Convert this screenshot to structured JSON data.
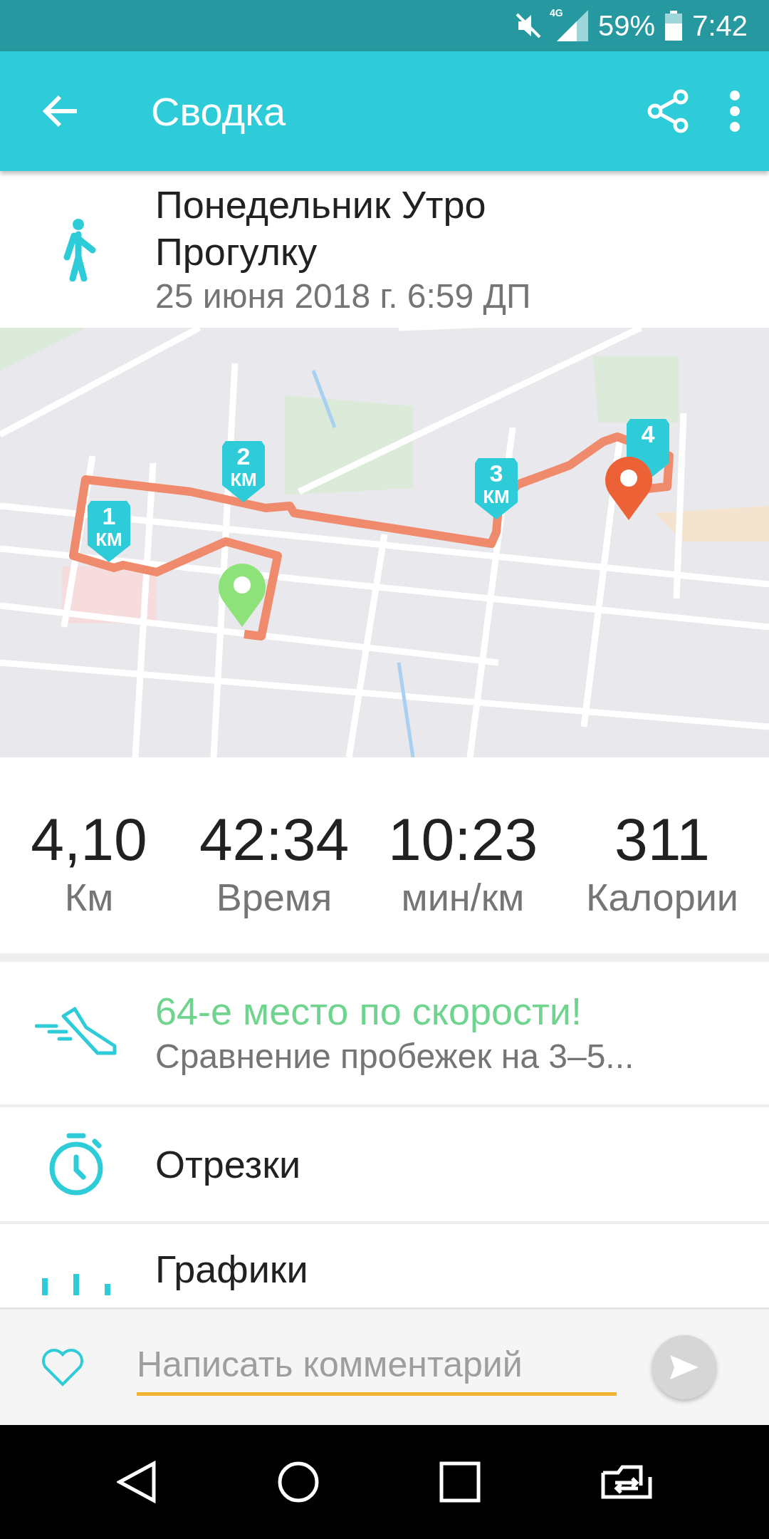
{
  "status_bar": {
    "network": "4G",
    "battery": "59%",
    "time": "7:42"
  },
  "app_bar": {
    "title": "Сводка"
  },
  "activity": {
    "title": "Понедельник Утро Прогулку",
    "date": "25 июня 2018 г. 6:59 ДП"
  },
  "map": {
    "kind": "picture",
    "km_markers": [
      {
        "number": "1",
        "unit": "КМ"
      },
      {
        "number": "2",
        "unit": "КМ"
      },
      {
        "number": "3",
        "unit": "КМ"
      },
      {
        "number": "4"
      }
    ]
  },
  "stats": [
    {
      "value": "4,10",
      "label": "Км"
    },
    {
      "value": "42:34",
      "label": "Время"
    },
    {
      "value": "10:23",
      "label": "мин/км"
    },
    {
      "value": "311",
      "label": "Калории"
    }
  ],
  "list": [
    {
      "kind": "ranking",
      "title": "64-е место по скорости!",
      "subtitle": "Сравнение пробежек на 3–5..."
    },
    {
      "kind": "splits",
      "title": "Отрезки"
    },
    {
      "kind": "charts",
      "title": "Графики"
    }
  ],
  "comment": {
    "placeholder": "Написать комментарий"
  }
}
